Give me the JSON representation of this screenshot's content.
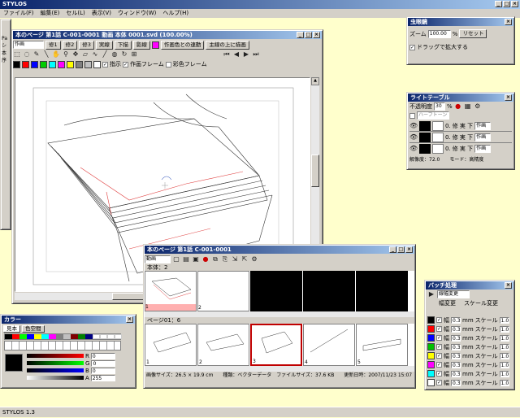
{
  "app": {
    "title": "STYLOS",
    "status": "STYLOS 1.3"
  },
  "menu": [
    "ファイル(F)",
    "編集(E)",
    "セル(L)",
    "表示(V)",
    "ウィンドウ(W)",
    "ヘルプ(H)"
  ],
  "canvas_window": {
    "title": "本のページ 第1話 C-001-0001 動画 本体 0001.svd (100.00%)",
    "layer_select": "作画",
    "layer_buttons": [
      "修1",
      "修2",
      "修3",
      "実線",
      "下描",
      "影線"
    ],
    "preview_label": "作画色との連動",
    "over_label": "主線の上に描画",
    "sub_labels": [
      "指示",
      "作画フレーム",
      "彩色フレーム"
    ],
    "palette": [
      "#000000",
      "#ff0000",
      "#0000ff",
      "#00c000",
      "#00ffff",
      "#ff00ff",
      "#ffff00",
      "#808080",
      "#c0c0c0",
      "#ffffff"
    ]
  },
  "zoom_panel": {
    "title": "虫眼鏡",
    "zoom_label": "ズーム",
    "zoom_value": "100.00",
    "unit": "%",
    "reset_label": "リセット",
    "drag_label": "ドラッグで拡大する"
  },
  "lighttable": {
    "title": "ライトテーブル",
    "opacity_label": "不透明度",
    "opacity_value": "30",
    "unit": "%",
    "mode_select": "ハーフトーン",
    "rows": [
      {
        "num": "0.",
        "opts": "修 実 下",
        "sel": "作画"
      },
      {
        "num": "0.",
        "opts": "修 実 下",
        "sel": "作画"
      },
      {
        "num": "0.",
        "opts": "修 実 下",
        "sel": "作画"
      }
    ],
    "footer": "解像度：72.0　　モード：高精度"
  },
  "color_panel": {
    "title": "カラー",
    "tabs": [
      "見本",
      "色空間"
    ],
    "labels": [
      "R",
      "G",
      "B",
      "A"
    ],
    "values": [
      "0",
      "0",
      "0",
      "255"
    ]
  },
  "timeline": {
    "title": "本のページ 第1話 C-001-0001",
    "layer_select": "動画",
    "track1_label": "本体：2",
    "track1_frames": [
      "1",
      "2"
    ],
    "track2_label": "ページ01：6",
    "track2_frames": [
      "1",
      "2",
      "3",
      "4",
      "5"
    ],
    "info": "画像サイズ：26.5 × 19.9 cm　　種類：ベクターデータ　ファイルサイズ：37.6 KB　　更新日時：2007/11/23 15:07"
  },
  "batch": {
    "title": "バッチ処理",
    "select": "線幅変更",
    "col1": "幅変更",
    "col2": "スケール変更",
    "width_label": "幅",
    "width_value": "0.3",
    "unit": "mm",
    "scale_label": "スケール",
    "scale_value": "1.0",
    "colors": [
      "#000000",
      "#ff0000",
      "#0000ff",
      "#00c000",
      "#ffff00",
      "#ff00ff",
      "#00ffff",
      "#ffffff"
    ]
  },
  "left_labels": [
    "Pa",
    "シ",
    "本",
    "序"
  ]
}
